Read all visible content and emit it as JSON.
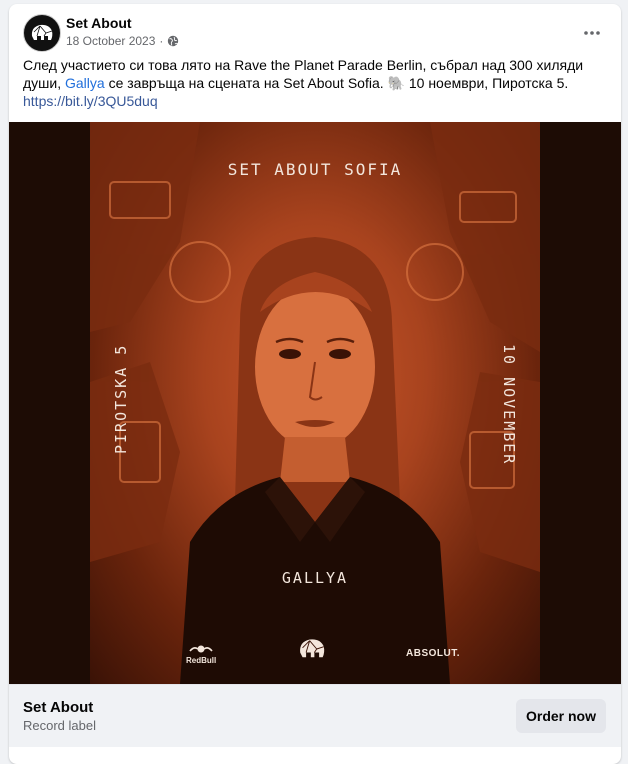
{
  "post": {
    "page_name": "Set About",
    "date": "18 October 2023",
    "date_separator": "·",
    "privacy_icon": "globe-icon",
    "text_part1": "След участието си това лято на Rave the Planet Parade Berlin, събрал над 300 хиляди души, ",
    "mention": "Gallya",
    "text_part2": " се завръща на сцената на Set About Sofia. ",
    "emoji": "🐘",
    "text_part3": " 10 ноември, Пиротска 5.",
    "link": "https://bit.ly/3QU5duq"
  },
  "poster": {
    "title": "SET ABOUT SOFIA",
    "left_text": "PIROTSKA 5",
    "right_text": "10 NOVEMBER",
    "artist": "GALLYA",
    "sponsor_left": "RedBull",
    "sponsor_right": "ABSOLUT."
  },
  "cta": {
    "name": "Set About",
    "subtitle": "Record label",
    "button": "Order now"
  },
  "colors": {
    "accent_link": "#216fdb",
    "poster_orange": "#c9562a",
    "poster_dark": "#1d0c05"
  }
}
